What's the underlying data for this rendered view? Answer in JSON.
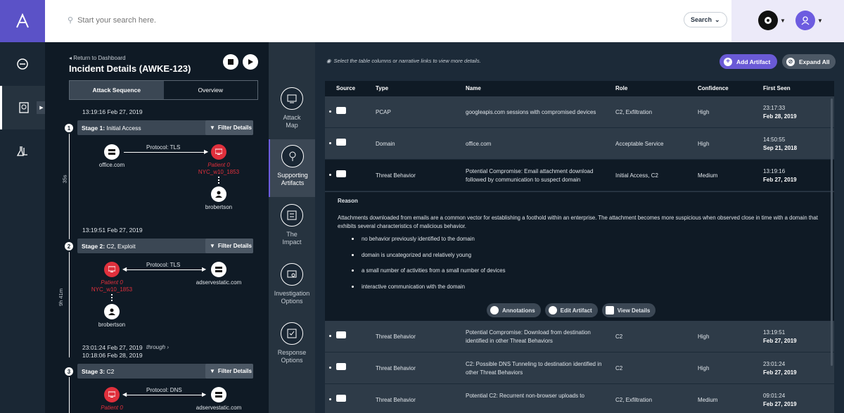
{
  "search": {
    "placeholder": "Start your search here.",
    "button_label": "Search"
  },
  "incident": {
    "back_label": "Return to Dashboard",
    "title": "Incident Details (AWKE-123)",
    "tabs": [
      {
        "label": "Attack Sequence"
      },
      {
        "label": "Overview"
      }
    ],
    "stages": [
      {
        "num": "1",
        "timestamp": "13:19:16 Feb 27, 2019",
        "label_bold": "Stage 1:",
        "label_rest": "Initial Access",
        "filter_label": "Filter Details",
        "protocol": "Protocol: TLS",
        "left_node": "office.com",
        "right_patient": "Patient 0",
        "right_host": "NYC_w10_1853",
        "user": "brobertson",
        "duration": "35s"
      },
      {
        "num": "2",
        "timestamp": "13:19:51 Feb 27, 2019",
        "label_bold": "Stage 2:",
        "label_rest": "C2, Exploit",
        "filter_label": "Filter Details",
        "protocol": "Protocol: TLS",
        "left_patient": "Patient 0",
        "left_host": "NYC_w10_1853",
        "right_node": "adservestatic.com",
        "user": "brobertson",
        "duration": "9h 41m"
      },
      {
        "num": "3",
        "timestamp": "23:01:24 Feb 27, 2019",
        "through": "through",
        "timestamp2": "10:18:06 Feb 28, 2019",
        "label_bold": "Stage 3:",
        "label_rest": "C2",
        "filter_label": "Filter Details",
        "protocol": "Protocol: DNS",
        "left_patient": "Patient 0",
        "right_node": "adservestatic.com"
      }
    ]
  },
  "vtabs": [
    {
      "label1": "Attack",
      "label2": "Map",
      "icon": "attack-map-icon"
    },
    {
      "label1": "Supporting",
      "label2": "Artifacts",
      "icon": "supporting-artifacts-icon"
    },
    {
      "label1": "The",
      "label2": "Impact",
      "icon": "impact-icon"
    },
    {
      "label1": "Investigation",
      "label2": "Options",
      "icon": "investigation-icon"
    },
    {
      "label1": "Response",
      "label2": "Options",
      "icon": "response-icon"
    }
  ],
  "main": {
    "hint": "Select the table columns or narrative links to view more details.",
    "add_label": "Add Artifact",
    "expand_label": "Expand All",
    "columns": [
      "Source",
      "Type",
      "Name",
      "Role",
      "Confidence",
      "First Seen"
    ],
    "rows": [
      {
        "type": "PCAP",
        "name": "googleapis.com sessions with compromised devices",
        "role": "C2, Exfiltration",
        "confidence": "High",
        "time": "23:17:33",
        "date": "Feb 28, 2019"
      },
      {
        "type": "Domain",
        "name": "office.com",
        "role": "Acceptable Service",
        "confidence": "High",
        "time": "14:50:55",
        "date": "Sep 21, 2018"
      },
      {
        "type": "Threat Behavior",
        "name": "Potential Compromise: Email attachment download followed by communication to suspect domain",
        "role": "Initial Access, C2",
        "confidence": "Medium",
        "time": "13:19:16",
        "date": "Feb 27, 2019"
      },
      {
        "type": "Threat Behavior",
        "name": "Potential Compromise: Download from destination identified in other Threat Behaviors",
        "role": "C2",
        "confidence": "High",
        "time": "13:19:51",
        "date": "Feb 27, 2019"
      },
      {
        "type": "Threat Behavior",
        "name": "C2: Possible DNS Tunneling to destination identified in other Threat Behaviors",
        "role": "C2",
        "confidence": "High",
        "time": "23:01:24",
        "date": "Feb 27, 2019"
      },
      {
        "type": "Threat Behavior",
        "name": "Potential C2: Recurrent non-browser uploads to",
        "role": "C2, Exfiltration",
        "confidence": "Medium",
        "time": "09:01:24",
        "date": "Feb 27, 2019"
      }
    ],
    "detail": {
      "heading": "Reason",
      "text": "Attachments downloaded from emails are a common vector for establishing a foothold within an enterprise. The attachment becomes more suspicious when observed close in time with a domain that exhibits several characteristics of malicious behavior.",
      "bullets": [
        "no behavior previously identified to the domain",
        "domain is uncategorized and relatively young",
        "a small number of activities from a small number of devices",
        "interactive communication with the domain"
      ],
      "actions": [
        "Annotations",
        "Edit Artifact",
        "View Details"
      ]
    }
  }
}
